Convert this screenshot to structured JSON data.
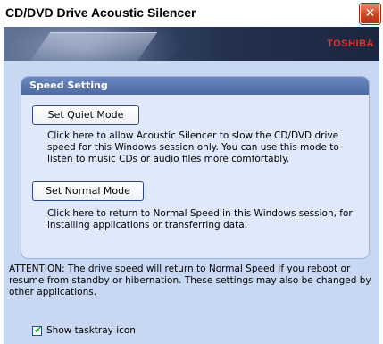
{
  "window": {
    "title": "CD/DVD Drive Acoustic Silencer",
    "close_glyph": "✕"
  },
  "banner": {
    "brand": "TOSHIBA"
  },
  "speed_panel": {
    "header": "Speed Setting",
    "quiet_button": "Set Quiet Mode",
    "quiet_desc": "Click here to allow Acoustic Silencer to slow the CD/DVD drive speed for this Windows session only. You can use this mode to listen to music CDs or audio files more comfortably.",
    "normal_button": "Set Normal Mode",
    "normal_desc": "Click here to return to Normal Speed in this Windows session, for installing applications or transferring data."
  },
  "attention": "ATTENTION: The drive speed will return to Normal Speed if you reboot or resume from standby or hibernation. These settings may also be changed by other applications.",
  "tasktray": {
    "label": "Show tasktray icon",
    "checked": true,
    "check_glyph": "✔"
  }
}
